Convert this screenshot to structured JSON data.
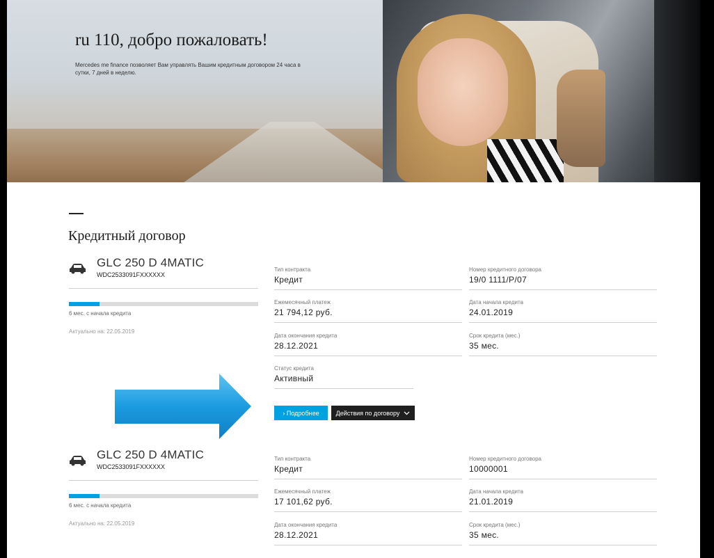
{
  "hero": {
    "title": "ru 110, добро пожаловать!",
    "subtitle": "Mercedes me finance позволяет Вам управлять Вашим кредитным договором 24 часа в сутки, 7 дней в неделю."
  },
  "section": {
    "title": "Кредитный договор"
  },
  "contracts": [
    {
      "car_model": "GLC 250 D 4MATIC",
      "vin": "WDC2533091FXXXXXX",
      "progress": {
        "label": "6 мес. с начала кредита",
        "fraction": 0.16
      },
      "actual": "Актуально на: 22.05.2019",
      "contract_type_label": "Тип контракта",
      "contract_type": "Кредит",
      "contract_number_label": "Номер кредитного договора",
      "contract_number": "19/0 1111/P/07",
      "monthly_payment_label": "Ежемесячный платеж",
      "monthly_payment": "21 794,12 руб.",
      "start_date_label": "Дата начала кредита",
      "start_date": "24.01.2019",
      "end_date_label": "Дата окончания кредита",
      "end_date": "28.12.2021",
      "term_label": "Срок кредита (мес.)",
      "term": "35 мес.",
      "status_label": "Статус кредита",
      "status": "Активный",
      "more_button": "› Подробнее",
      "actions_button": "Действия по договору"
    },
    {
      "car_model": "GLC 250 D 4MATIC",
      "vin": "WDC2533091FXXXXXX",
      "progress": {
        "label": "6 мес. с начала кредита",
        "fraction": 0.16
      },
      "actual": "Актуально на: 22.05.2019",
      "contract_type_label": "Тип контракта",
      "contract_type": "Кредит",
      "contract_number_label": "Номер кредитного договора",
      "contract_number": "10000001",
      "monthly_payment_label": "Ежемесячный платеж",
      "monthly_payment": "17 101,62 руб.",
      "start_date_label": "Дата начала кредита",
      "start_date": "21.01.2019",
      "end_date_label": "Дата окончания кредита",
      "end_date": "28.12.2021",
      "term_label": "Срок кредита (мес.)",
      "term": "35 мес."
    }
  ],
  "colors": {
    "accent": "#00a1e0",
    "dark_button": "#1f1f1f",
    "arrow": "#1b9be0"
  },
  "icons": {
    "car": "car-icon",
    "chevron": "chevron-down-icon",
    "arrow": "arrow-right-icon"
  }
}
